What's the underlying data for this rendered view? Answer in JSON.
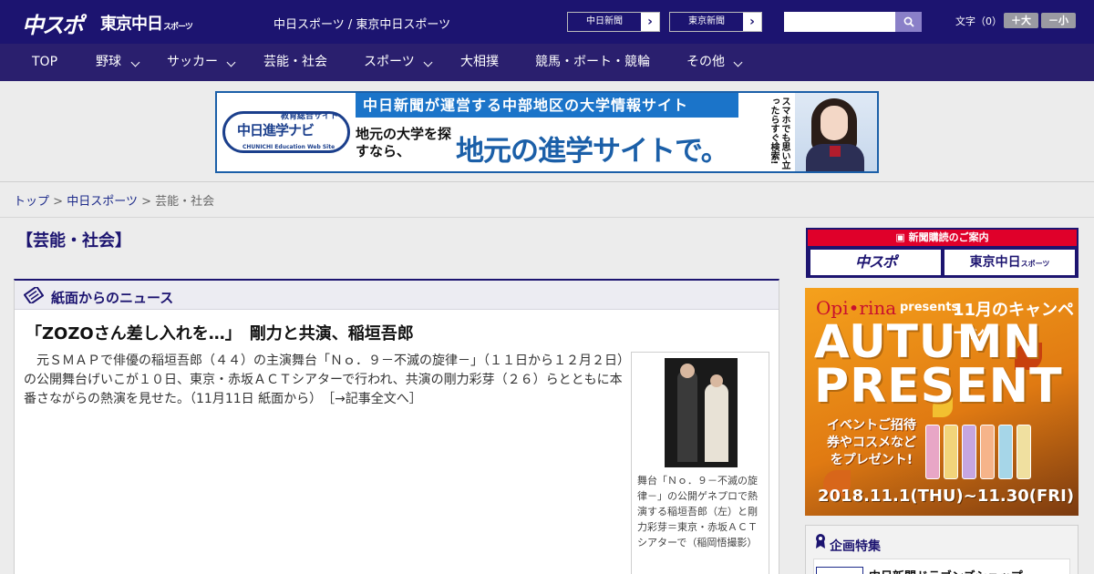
{
  "header": {
    "logo_chuspo": "中スポ",
    "logo_tokyo_main": "東京中日",
    "logo_tokyo_small": "スポーツ",
    "site_title": "中日スポーツ / 東京中日スポーツ",
    "paper_links": [
      {
        "label": "中日新聞",
        "arrow": "›"
      },
      {
        "label": "東京新聞",
        "arrow": "›"
      }
    ],
    "search": {
      "placeholder": "",
      "icon": "search-icon"
    },
    "font_size_label": "文字（0）",
    "font_bigger": "＋大",
    "font_smaller": "－小"
  },
  "nav": {
    "items": [
      {
        "label": "TOP",
        "dropdown": false
      },
      {
        "label": "野球",
        "dropdown": true
      },
      {
        "label": "サッカー",
        "dropdown": true
      },
      {
        "label": "芸能・社会",
        "dropdown": false
      },
      {
        "label": "スポーツ",
        "dropdown": true
      },
      {
        "label": "大相撲",
        "dropdown": false
      },
      {
        "label": "競馬・ボート・競輪",
        "dropdown": false
      },
      {
        "label": "その他",
        "dropdown": true
      }
    ]
  },
  "ad_banner": {
    "edu_sub": "教育総合サイト",
    "edu_main": "中日進学ナビ",
    "edu_en": "CHUNICHI Education Web Site",
    "head": "中日新聞が運営する中部地区の大学情報サイト",
    "sub": "地元の大学を探すなら、",
    "big": "地元の進学サイトで。",
    "phone_text": "スマホでも思い立ったらすぐ検索!"
  },
  "breadcrumb": {
    "items": [
      "トップ",
      "中日スポーツ",
      "芸能・社会"
    ],
    "separator": ">"
  },
  "main": {
    "section_title": "【芸能・社会】",
    "news_box_title": "紙面からのニュース",
    "article": {
      "headline": "「ZOZOさん差し入れを…」　剛力と共演、稲垣吾郎",
      "body": "　元ＳＭＡＰで俳優の稲垣吾郎（４４）の主演舞台「Ｎｏ．９－不滅の旋律－」（１１日から１２月２日）の公開舞台げいこが１０日、東京・赤坂ＡＣＴシアターで行われ、共演の剛力彩芽（２６）らとともに本番さながらの熱演を見せた。（11月11日 紙面から）",
      "more_link": "［→記事全文へ］",
      "photo_caption": "舞台「Ｎｏ．９－不滅の旋律－」の公開ゲネプロで熱演する稲垣吾郎（左）と剛力彩芽＝東京・赤坂ＡＣＴシアターで（稲岡悟撮影）"
    }
  },
  "sidebar": {
    "subscribe_head": "新聞購読のご案内",
    "subscribe_chuspo": "中スポ",
    "subscribe_tokyo": "東京中日",
    "subscribe_tokyo_small": "スポーツ",
    "autumn_ad": {
      "brand": "Opi•rina",
      "presents": "presents",
      "campaign": "11月のキャンペーン",
      "title1": "AUTUMN",
      "title2": "PRESENT",
      "event": "イベントご招待券やコスメなどをプレゼント!",
      "dates": "2018.11.1(THU)~11.30(FRI)"
    },
    "feature_title": "企画特集",
    "feature_item": "中日新聞ドラゴンズショップ"
  },
  "colors": {
    "header_bg": "#1c1470",
    "nav_bg": "#2a1f6e",
    "link": "#1c2a8a",
    "subscribe_red": "#e0002a"
  }
}
